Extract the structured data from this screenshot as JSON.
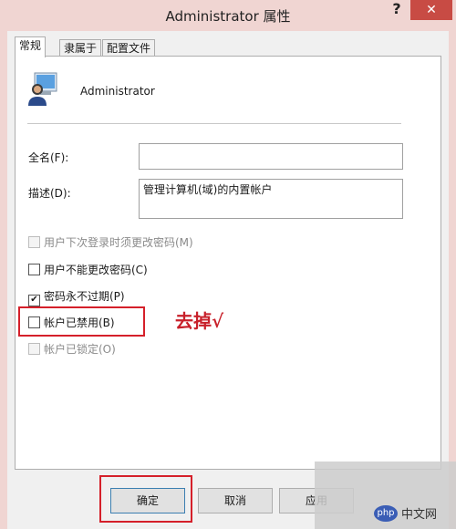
{
  "window": {
    "title": "Administrator 属性",
    "help_label": "?",
    "close_label": "✕"
  },
  "tabs": [
    {
      "label": "常规",
      "active": true
    },
    {
      "label": "隶属于",
      "active": false
    },
    {
      "label": "配置文件",
      "active": false
    }
  ],
  "user": {
    "name": "Administrator",
    "icon": "user-icon"
  },
  "fields": {
    "fullname": {
      "label": "全名(F):",
      "value": ""
    },
    "description": {
      "label": "描述(D):",
      "value": "管理计算机(域)的内置帐户"
    }
  },
  "checkboxes": [
    {
      "label": "用户下次登录时须更改密码(M)",
      "checked": false,
      "enabled": false
    },
    {
      "label": "用户不能更改密码(C)",
      "checked": false,
      "enabled": true
    },
    {
      "label": "密码永不过期(P)",
      "checked": true,
      "enabled": true
    },
    {
      "label": "帐户已禁用(B)",
      "checked": false,
      "enabled": true
    },
    {
      "label": "帐户已锁定(O)",
      "checked": false,
      "enabled": false
    }
  ],
  "annotation": "去掉√",
  "buttons": {
    "ok": "确定",
    "cancel": "取消",
    "apply": "应用"
  },
  "watermark": {
    "logo": "php",
    "text": "中文网"
  },
  "colors": {
    "highlight": "#d5202a",
    "title_bar": "#f0d5d2",
    "close": "#c84b44"
  }
}
